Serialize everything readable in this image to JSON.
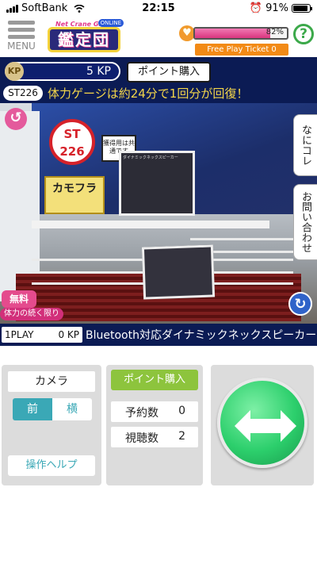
{
  "statusbar": {
    "carrier": "SoftBank",
    "time": "22:15",
    "battery": "91%"
  },
  "header": {
    "menu_label": "MENU",
    "logo_sub": "Net Crane Game",
    "logo_main": "鑑定団",
    "logo_badge": "ONLINE",
    "hp_percent": 82,
    "hp_text": "82%",
    "ticket": "Free Play Ticket 0",
    "help_icon_text": "?"
  },
  "kp": {
    "icon_text": "KP",
    "value": "5 KP",
    "buy_label": "ポイント購入"
  },
  "message": {
    "station": "ST226",
    "text": "体力ゲージは約24分で1回分が回復！"
  },
  "camera": {
    "sign_text": "ST\n226",
    "note_text": "獲得用は共通です",
    "kamo_text": "カモフラ",
    "free_text": "無料",
    "free_sub": "体力の続く限り",
    "side_tab_1": "なにコレ",
    "side_tab_2": "お問い合わせ"
  },
  "item": {
    "play_label": "1PLAY",
    "play_cost": "0 KP",
    "name": "Bluetooth対応ダイナミックネックスピーカー"
  },
  "controls": {
    "camera_title": "カメラ",
    "front_label": "前",
    "side_label": "横",
    "help_label": "操作ヘルプ",
    "buy_label": "ポイント購入",
    "reservation_label": "予約数",
    "reservation_value": "0",
    "viewers_label": "視聴数",
    "viewers_value": "2"
  },
  "colors": {
    "navy": "#0b1b54",
    "accent_teal": "#3aa8b6",
    "buy_green": "#8dc43d",
    "ticket_orange": "#f28a16",
    "hp_pink": "#e44b8d"
  }
}
